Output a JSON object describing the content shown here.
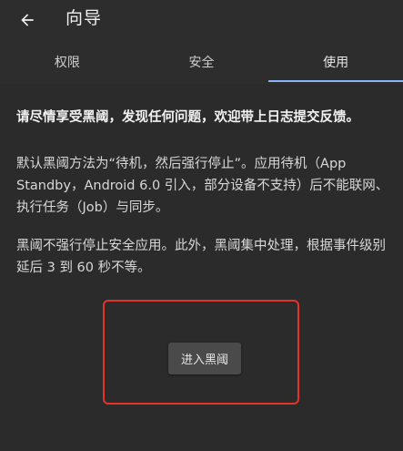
{
  "appbar": {
    "title": "向导",
    "back_icon": "arrow-left-icon"
  },
  "tabs": [
    {
      "label": "权限",
      "active": false
    },
    {
      "label": "安全",
      "active": false
    },
    {
      "label": "使用",
      "active": true
    }
  ],
  "content": {
    "lead": "请尽情享受黑阈，发现任何问题，欢迎带上日志提交反馈。",
    "paragraph1": "默认黑阈方法为“待机，然后强行停止”。应用待机（App Standby，Android 6.0 引入，部分设备不支持）后不能联网、执行任务（Job）与同步。",
    "paragraph2": "黑阈不强行停止安全应用。此外，黑阈集中处理，根据事件级别延后 3 到 60 秒不等。"
  },
  "action": {
    "enter_label": "进入黑阈"
  },
  "colors": {
    "background": "#2b2b2b",
    "tab_indicator": "#8ab4f8",
    "highlight_border": "#e3332a",
    "button_bg": "#4a4a4a"
  }
}
